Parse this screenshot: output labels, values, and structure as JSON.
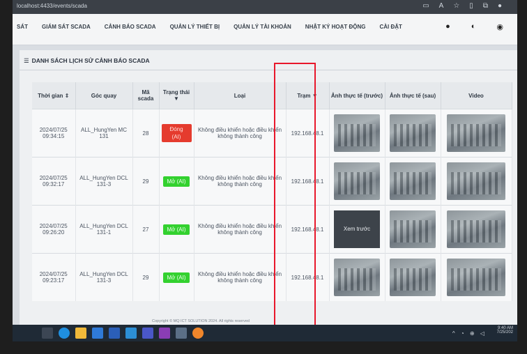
{
  "browser": {
    "url": "localhost:4433/events/scada"
  },
  "nav": {
    "items": [
      "SÁT",
      "GIÁM SÁT SCADA",
      "CẢNH BÁO SCADA",
      "QUẢN LÝ THIẾT BỊ",
      "QUẢN LÝ TÀI KHOẢN",
      "NHẬT KÝ HOẠT ĐỘNG",
      "CÀI ĐẶT"
    ],
    "icons": [
      "bell-icon",
      "contrast-icon",
      "globe-icon"
    ]
  },
  "page": {
    "title": "DANH SÁCH LỊCH SỬ CẢNH BÁO SCADA"
  },
  "table": {
    "headers": {
      "time": "Thời gian",
      "angle": "Góc quay",
      "scada": "Mã scada",
      "status": "Trạng thái",
      "type": "Loại",
      "station": "Trạm",
      "img_before": "Ảnh thực tế (trước)",
      "img_after": "Ảnh thực tế (sau)",
      "video": "Video"
    },
    "rows": [
      {
        "date": "2024/07/25",
        "time": "09:34:15",
        "angle": "ALL_HungYen MC 131",
        "scada": "28",
        "status": "Đóng (AI)",
        "status_color": "#e53b2e",
        "type": "Không điều khiển hoặc điều khiển không thành công",
        "station": "192.168.48.1"
      },
      {
        "date": "2024/07/25",
        "time": "09:32:17",
        "angle": "ALL_HungYen DCL 131-3",
        "scada": "29",
        "status": "Mở (AI)",
        "status_color": "#33d12f",
        "type": "Không điều khiển hoặc điều khiển không thành công",
        "station": "192.168.48.1"
      },
      {
        "date": "2024/07/25",
        "time": "09:26:20",
        "angle": "ALL_HungYen DCL 131-1",
        "scada": "27",
        "status": "Mở (AI)",
        "status_color": "#33d12f",
        "type": "Không điều khiển hoặc điều khiển không thành công",
        "station": "192.168.48.1",
        "preview_label": "Xem trước"
      },
      {
        "date": "2024/07/25",
        "time": "09:23:17",
        "angle": "ALL_HungYen DCL 131-3",
        "scada": "29",
        "status": "Mở (AI)",
        "status_color": "#33d12f",
        "type": "Không điều khiển hoặc điều khiển không thành công",
        "station": "192.168.48.1"
      }
    ]
  },
  "footer": {
    "copyright": "Copyright © MQ ICT SOLUTION 2024. All rights reserved"
  },
  "taskbar": {
    "time": "9:40 AM",
    "date": "7/25/202"
  },
  "colors": {
    "highlight": "#e8172b"
  }
}
